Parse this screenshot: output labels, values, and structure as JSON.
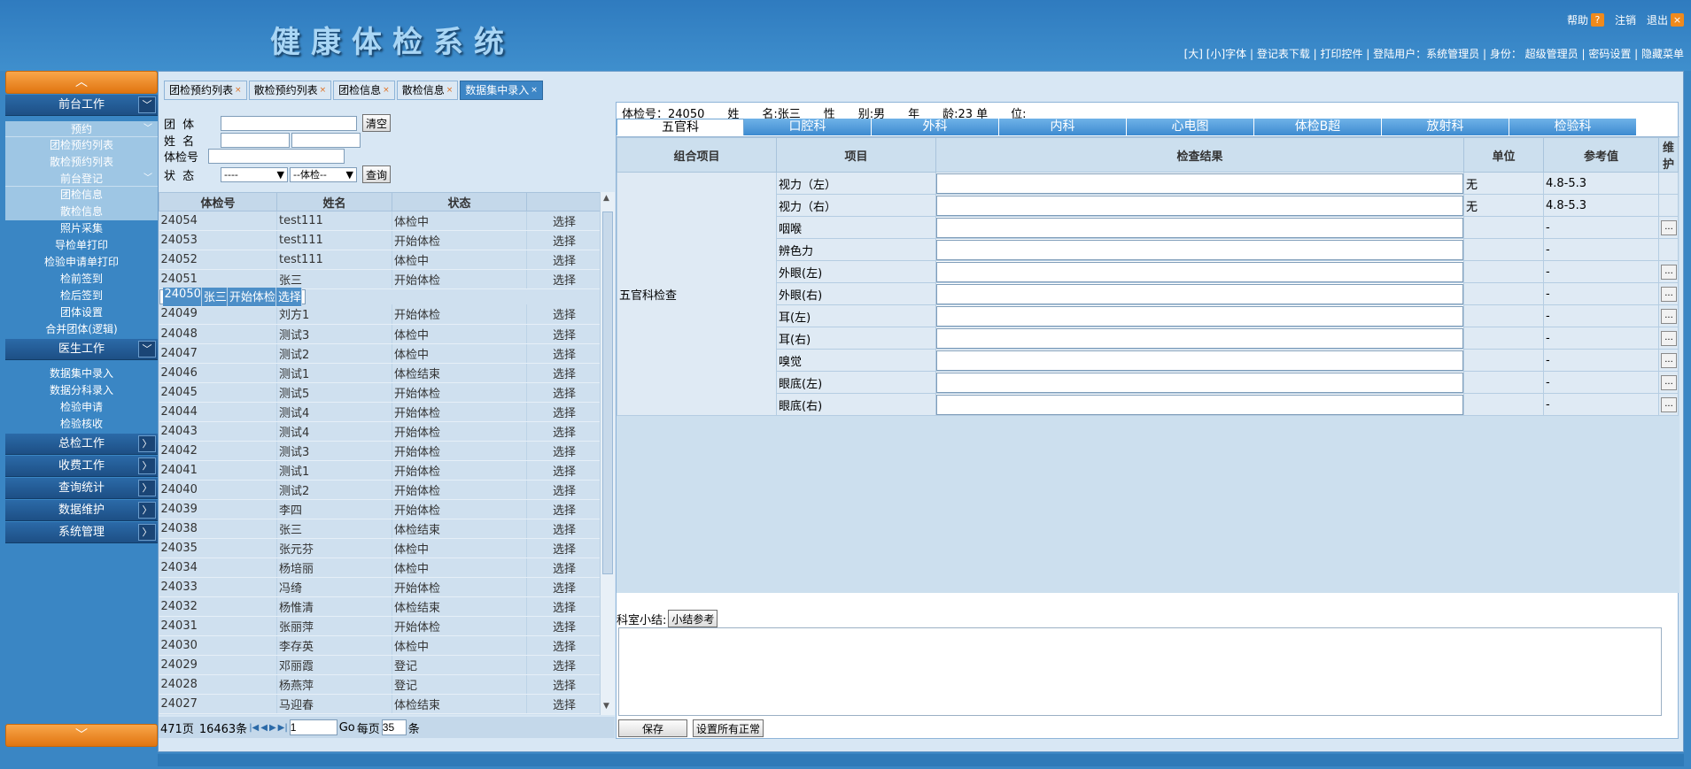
{
  "app": {
    "title": "健康体检系统"
  },
  "top": {
    "help": "帮助",
    "help_icon": "?",
    "logout": "注销",
    "exit": "退出",
    "exit_icon": "×"
  },
  "nav": {
    "links": "[大] [小]字体 | 登记表下载 | 打印控件 | 登陆用户：系统管理员 | 身份： 超级管理员 | 密码设置 | 隐藏菜单"
  },
  "sidebar": {
    "up": "︿",
    "down": "﹀",
    "sections": [
      {
        "label": "前台工作",
        "arrow": "﹀"
      },
      {
        "label": "医生工作",
        "arrow": "﹀"
      },
      {
        "label": "总检工作",
        "arrow": "〉"
      },
      {
        "label": "收费工作",
        "arrow": "〉"
      },
      {
        "label": "查询统计",
        "arrow": "〉"
      },
      {
        "label": "数据维护",
        "arrow": "〉"
      },
      {
        "label": "系统管理",
        "arrow": "〉"
      }
    ],
    "sub_yuyue": "预约",
    "sub_qiantai": "前台登记",
    "sub_arrow": "﹀",
    "yuyue_items": [
      "团检预约列表",
      "散检预约列表"
    ],
    "qiantai_items": [
      "团检信息",
      "散检信息",
      "照片采集",
      "导检单打印",
      "检验申请单打印",
      "检前签到",
      "检后签到",
      "团体设置",
      "合并团体(逻辑)"
    ],
    "doctor_items": [
      "数据集中录入",
      "数据分科录入",
      "检验申请",
      "检验核收"
    ]
  },
  "tabs": [
    {
      "label": "团检预约列表",
      "x": "×"
    },
    {
      "label": "散检预约列表",
      "x": "×"
    },
    {
      "label": "团检信息",
      "x": "×"
    },
    {
      "label": "散检信息",
      "x": "×"
    },
    {
      "label": "数据集中录入",
      "x": "×"
    }
  ],
  "form": {
    "group_label": "团 体",
    "name_label": "姓 名",
    "id_label": "体检号",
    "status_label": "状 态",
    "clear": "清空",
    "query": "查询",
    "status_sel": "----",
    "status_sel2": "--体检--",
    "caret": "▼"
  },
  "grid": {
    "headers": [
      "体检号",
      "姓名",
      "状态",
      ""
    ],
    "pick": "选择",
    "rows": [
      [
        "24054",
        "test111",
        "体检中"
      ],
      [
        "24053",
        "test111",
        "开始体检"
      ],
      [
        "24052",
        "test111",
        "体检中"
      ],
      [
        "24051",
        "张三",
        "开始体检"
      ],
      [
        "24050",
        "张三",
        "开始体检"
      ],
      [
        "24049",
        "刘方1",
        "开始体检"
      ],
      [
        "24048",
        "测试3",
        "体检中"
      ],
      [
        "24047",
        "测试2",
        "体检中"
      ],
      [
        "24046",
        "测试1",
        "体检结束"
      ],
      [
        "24045",
        "测试5",
        "开始体检"
      ],
      [
        "24044",
        "测试4",
        "开始体检"
      ],
      [
        "24043",
        "测试4",
        "开始体检"
      ],
      [
        "24042",
        "测试3",
        "开始体检"
      ],
      [
        "24041",
        "测试1",
        "开始体检"
      ],
      [
        "24040",
        "测试2",
        "开始体检"
      ],
      [
        "24039",
        "李四",
        "开始体检"
      ],
      [
        "24038",
        "张三",
        "体检结束"
      ],
      [
        "24035",
        "张元芬",
        "体检中"
      ],
      [
        "24034",
        "杨培丽",
        "体检中"
      ],
      [
        "24033",
        "冯绮",
        "开始体检"
      ],
      [
        "24032",
        "杨惟清",
        "体检结束"
      ],
      [
        "24031",
        "张丽萍",
        "开始体检"
      ],
      [
        "24030",
        "李存英",
        "体检中"
      ],
      [
        "24029",
        "邓丽霞",
        "登记"
      ],
      [
        "24028",
        "杨燕萍",
        "登记"
      ],
      [
        "24027",
        "马迎春",
        "体检结束"
      ]
    ],
    "selected_index": 4
  },
  "pager": {
    "pages": "471页",
    "count": "16463条",
    "page": "1",
    "go": "Go",
    "per": "每页",
    "size": "35",
    "unit": "条",
    "first": "|◀",
    "prev": "◀",
    "next": "▶",
    "last": "▶|"
  },
  "patient": {
    "info": "体检号：24050　　姓　　名:张三　　性　　别:男　　年　　龄:23 单　　位:"
  },
  "dept_tabs": [
    "五官科",
    "口腔科",
    "外科",
    "内科",
    "心电图",
    "体检B超",
    "放射科",
    "检验科"
  ],
  "detail": {
    "headers": [
      "组合项目",
      "项目",
      "检查结果",
      "单位",
      "参考值",
      "维护"
    ],
    "group": "五官科检查",
    "dots": "...",
    "rows": [
      {
        "item": "视力（左）",
        "unit": "无",
        "ref": "4.8-5.3",
        "dots": false
      },
      {
        "item": "视力（右）",
        "unit": "无",
        "ref": "4.8-5.3",
        "dots": false
      },
      {
        "item": "咽喉",
        "unit": "",
        "ref": "-",
        "dots": true
      },
      {
        "item": "辨色力",
        "unit": "",
        "ref": "-",
        "dots": false
      },
      {
        "item": "外眼(左)",
        "unit": "",
        "ref": "-",
        "dots": true
      },
      {
        "item": "外眼(右)",
        "unit": "",
        "ref": "-",
        "dots": true
      },
      {
        "item": "耳(左)",
        "unit": "",
        "ref": "-",
        "dots": true
      },
      {
        "item": "耳(右)",
        "unit": "",
        "ref": "-",
        "dots": true
      },
      {
        "item": "嗅觉",
        "unit": "",
        "ref": "-",
        "dots": true
      },
      {
        "item": "眼底(左)",
        "unit": "",
        "ref": "-",
        "dots": true
      },
      {
        "item": "眼底(右)",
        "unit": "",
        "ref": "-",
        "dots": true
      }
    ]
  },
  "summary": {
    "label": "科室小结:",
    "ref_btn": "小结参考",
    "save": "保存",
    "all_normal": "设置所有正常"
  }
}
